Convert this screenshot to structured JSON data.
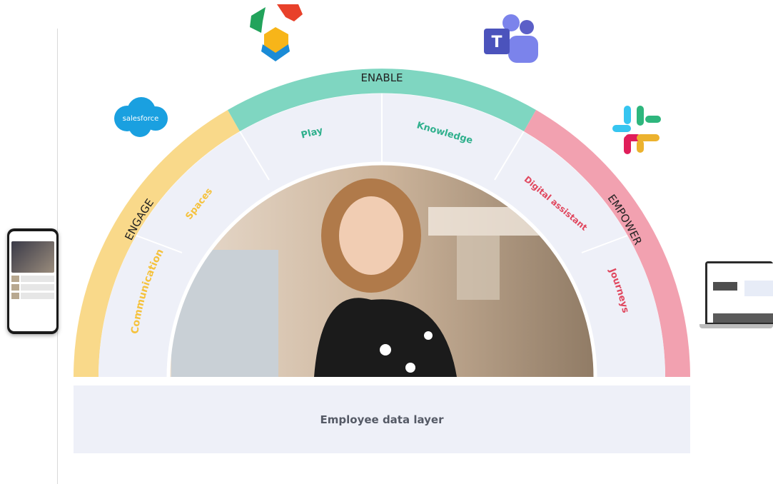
{
  "diagram": {
    "pillars": {
      "engage": "ENGAGE",
      "enable": "ENABLE",
      "empower": "EMPOWER"
    },
    "modules": {
      "communication": "Communication",
      "spaces": "Spaces",
      "play": "Play",
      "knowledge": "Knowledge",
      "digital_assistant": "Digital assistant",
      "journeys": "Journeys"
    },
    "base_layer": "Employee data layer"
  },
  "integrations": {
    "salesforce": "salesforce",
    "teams_letter": "T"
  },
  "colors": {
    "engage": "#f9d98a",
    "enable": "#7fd6c1",
    "empower": "#f2a1b0",
    "engage_text": "#f5c23e",
    "enable_text": "#2fb08d",
    "empower_text": "#e0485f",
    "inner_ring": "#eef0f8",
    "data_layer": "#eef0f8"
  }
}
